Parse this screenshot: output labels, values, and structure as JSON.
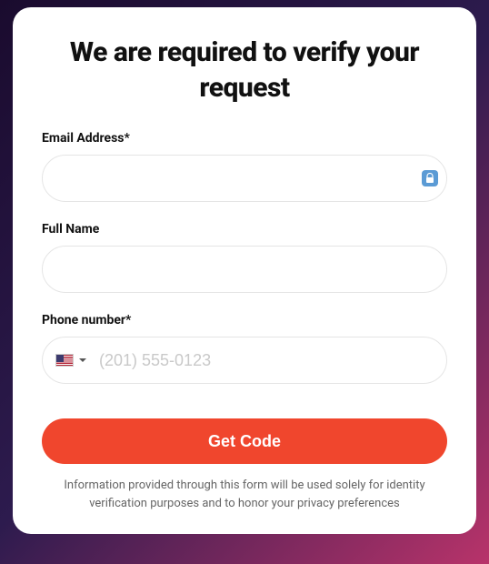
{
  "title": "We are required to verify your request",
  "fields": {
    "email": {
      "label": "Email Address*",
      "value": ""
    },
    "fullname": {
      "label": "Full Name",
      "value": ""
    },
    "phone": {
      "label": "Phone number*",
      "placeholder": "(201) 555-0123",
      "value": "",
      "country": "US"
    }
  },
  "submit_label": "Get Code",
  "disclaimer": "Information provided through this form will be used solely for identity verification purposes and to honor your privacy preferences"
}
